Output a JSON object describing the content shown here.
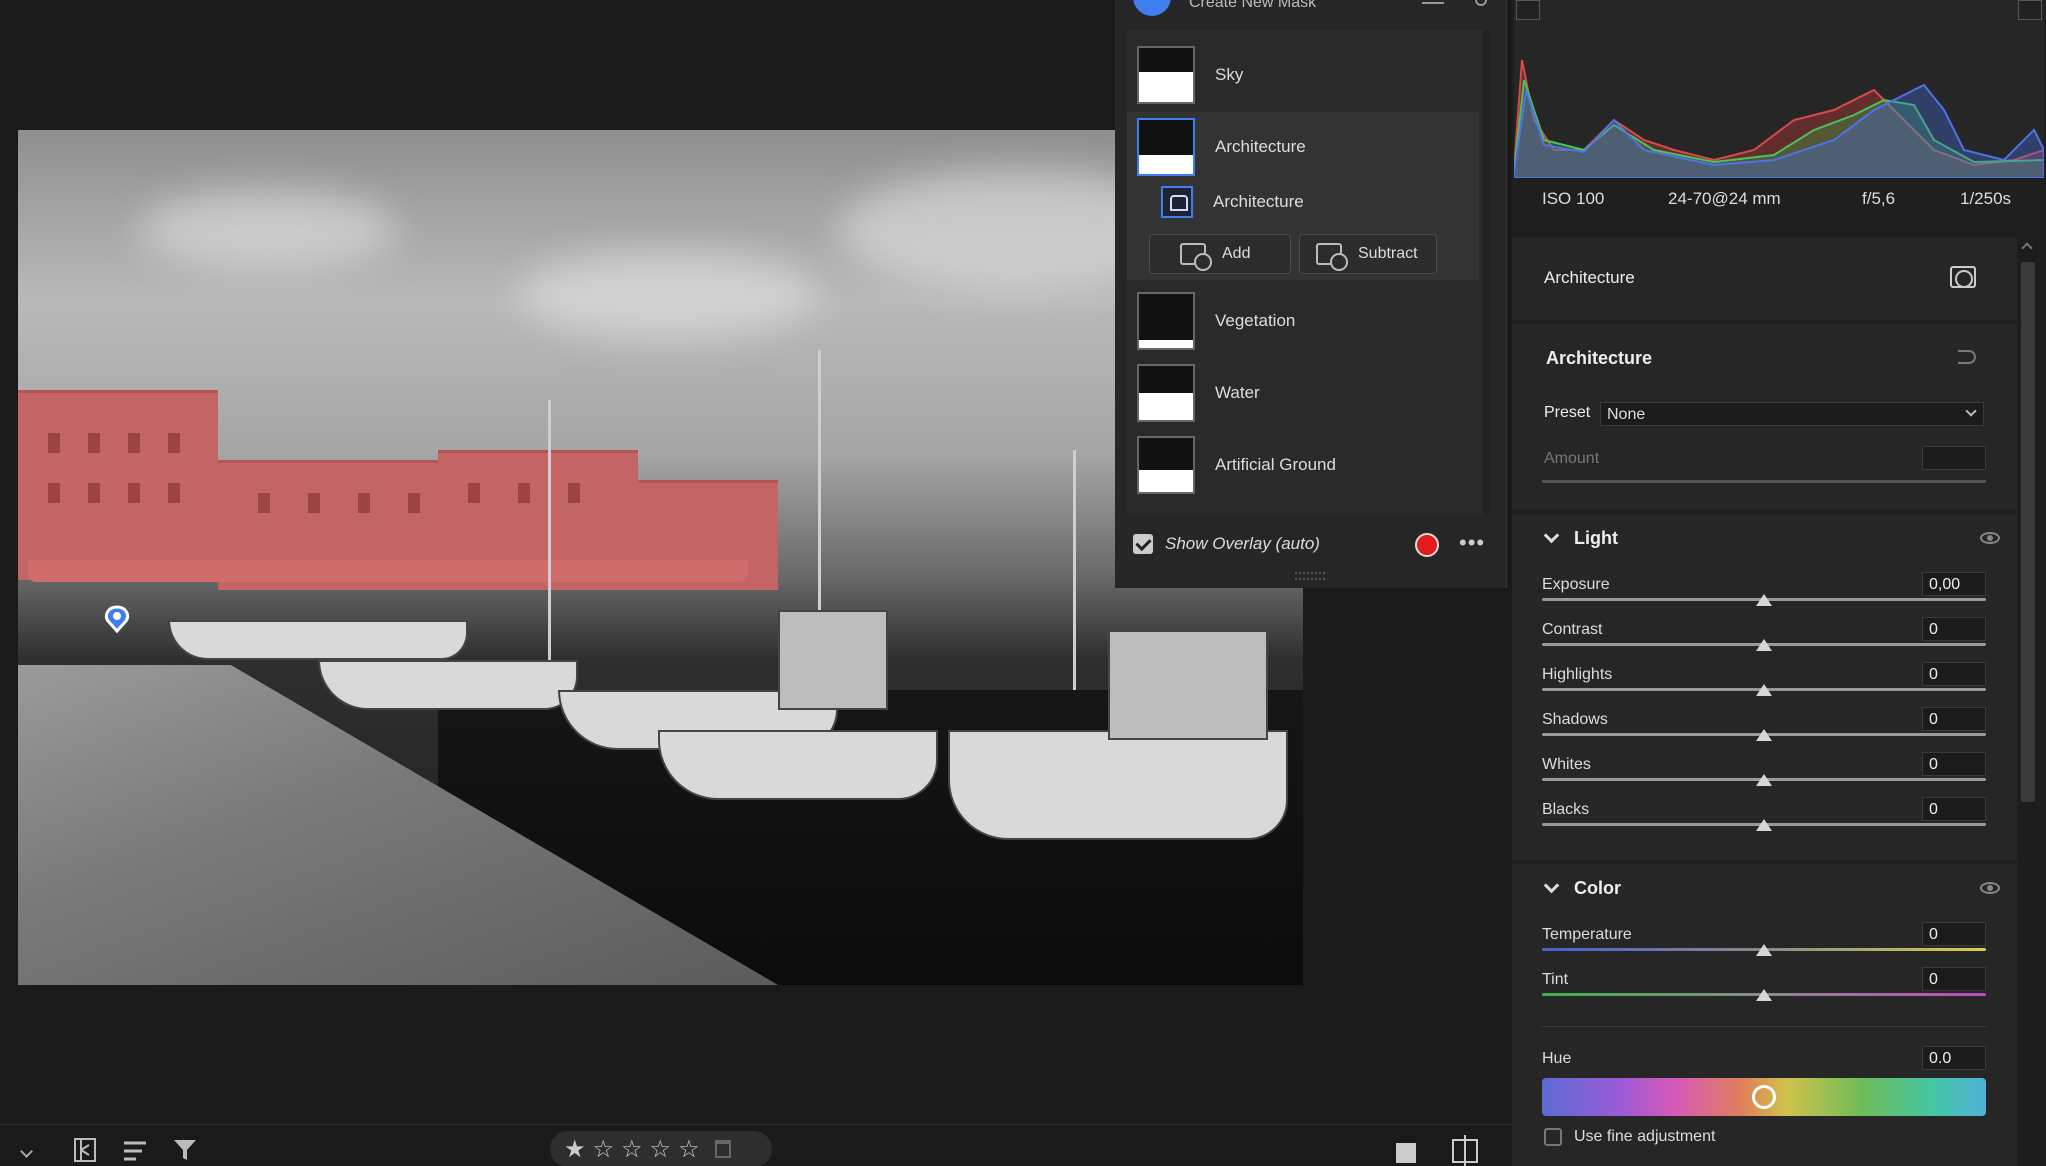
{
  "masks_panel": {
    "header_title": "Create New Mask",
    "masks": [
      {
        "name": "Sky",
        "fill": 0.55
      },
      {
        "name": "Architecture",
        "fill": 0.35,
        "selected": true
      },
      {
        "name": "Vegetation",
        "fill": 0.15
      },
      {
        "name": "Water",
        "fill": 0.5
      },
      {
        "name": "Artificial Ground",
        "fill": 0.4
      }
    ],
    "sub_component": "Architecture",
    "add_label": "Add",
    "subtract_label": "Subtract",
    "show_overlay_label": "Show Overlay (auto)",
    "overlay_color": "#e3191c"
  },
  "exif": {
    "iso": "ISO 100",
    "lens": "24-70@24 mm",
    "aperture": "f/5,6",
    "shutter": "1/250s"
  },
  "adjustments": {
    "mask_name": "Architecture",
    "section_title": "Architecture",
    "preset_label": "Preset",
    "preset_value": "None",
    "amount_label": "Amount",
    "light": {
      "title": "Light",
      "params": [
        {
          "label": "Exposure",
          "value": "0,00"
        },
        {
          "label": "Contrast",
          "value": "0"
        },
        {
          "label": "Highlights",
          "value": "0"
        },
        {
          "label": "Shadows",
          "value": "0"
        },
        {
          "label": "Whites",
          "value": "0"
        },
        {
          "label": "Blacks",
          "value": "0"
        }
      ]
    },
    "color": {
      "title": "Color",
      "params": [
        {
          "label": "Temperature",
          "value": "0"
        },
        {
          "label": "Tint",
          "value": "0"
        }
      ],
      "hue_label": "Hue",
      "hue_value": "0.0",
      "fine_adjust_label": "Use fine adjustment"
    }
  },
  "bottom_bar": {
    "stars": [
      "★",
      "☆",
      "☆",
      "☆",
      "☆"
    ]
  },
  "colors": {
    "accent": "#3f7df0",
    "mask_overlay": "#c46565"
  }
}
